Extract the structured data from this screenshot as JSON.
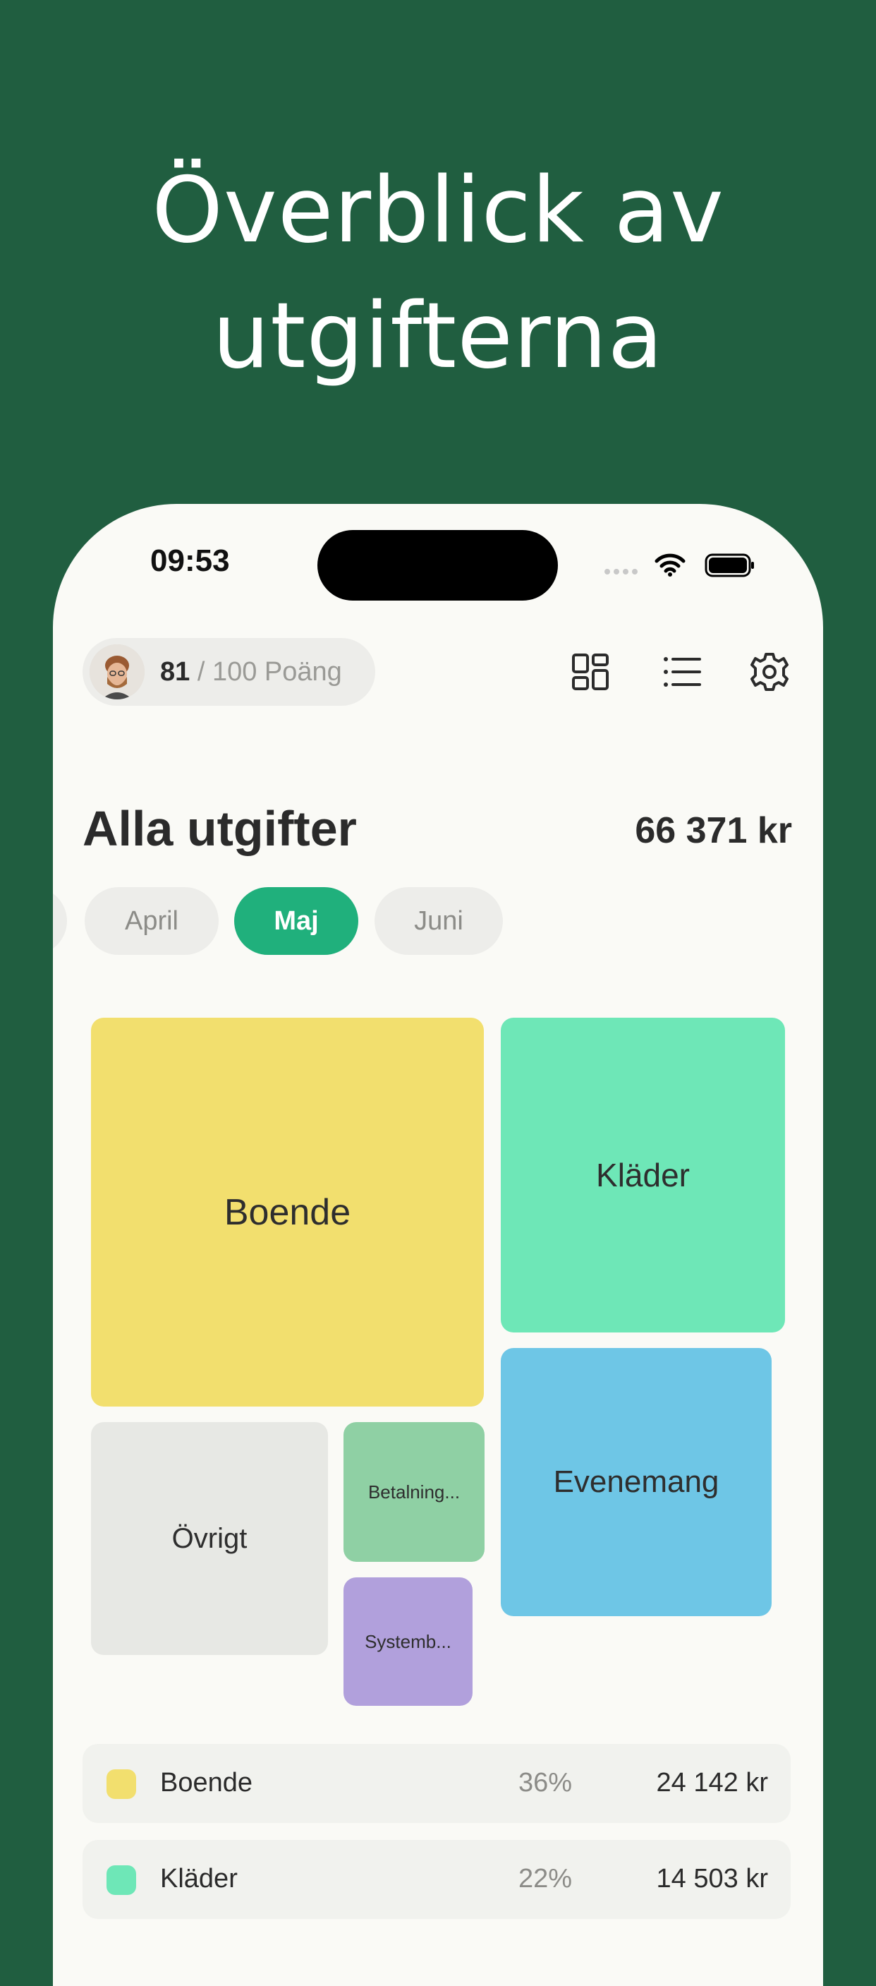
{
  "headline": {
    "line1": "Överblick av",
    "line2": "utgifterna"
  },
  "status_bar": {
    "time": "09:53"
  },
  "header": {
    "score_value": "81",
    "score_suffix": " / 100 Poäng",
    "icons": [
      "grid-view-icon",
      "list-view-icon",
      "settings-gear-icon"
    ]
  },
  "summary": {
    "title": "Alla utgifter",
    "total": "66 371 kr"
  },
  "months": [
    {
      "label": "",
      "active": false
    },
    {
      "label": "April",
      "active": false
    },
    {
      "label": "Maj",
      "active": true
    },
    {
      "label": "Juni",
      "active": false
    }
  ],
  "treemap": [
    {
      "label": "Boende",
      "color": "#f2df6e"
    },
    {
      "label": "Kläder",
      "color": "#6ee7b7"
    },
    {
      "label": "Evenemang",
      "color": "#6ec6e6"
    },
    {
      "label": "Övrigt",
      "color": "#e7e8e4"
    },
    {
      "label": "Betalning...",
      "color": "#8fd0a4"
    },
    {
      "label": "Systemb...",
      "color": "#b1a0dc"
    }
  ],
  "legend": [
    {
      "name": "Boende",
      "percent": "36%",
      "amount": "24 142 kr",
      "color": "#f2df6e"
    },
    {
      "name": "Kläder",
      "percent": "22%",
      "amount": "14 503 kr",
      "color": "#6ee7b7"
    }
  ]
}
